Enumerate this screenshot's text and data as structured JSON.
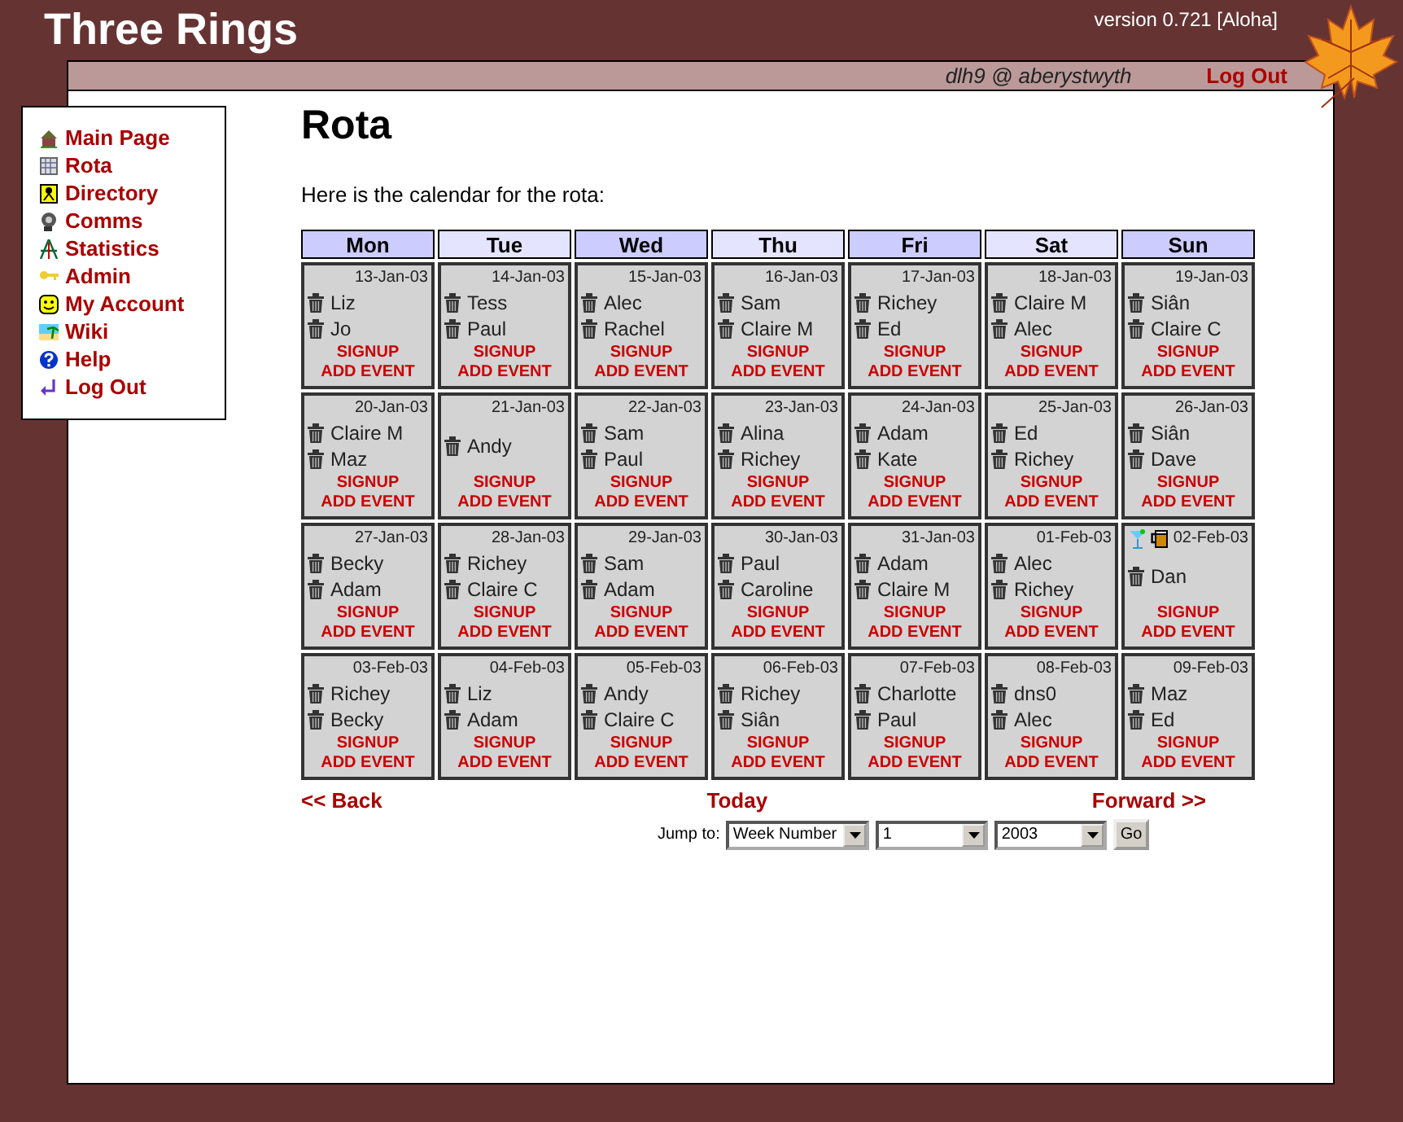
{
  "header": {
    "title": "Three Rings",
    "version": "version 0.721 [Aloha]"
  },
  "topbar": {
    "user": "dlh9 @ aberystwyth",
    "logout": "Log Out"
  },
  "sidebar": {
    "items": [
      {
        "label": "Main Page",
        "kind": "house"
      },
      {
        "label": "Rota",
        "kind": "grid"
      },
      {
        "label": "Directory",
        "kind": "card"
      },
      {
        "label": "Comms",
        "kind": "phone"
      },
      {
        "label": "Statistics",
        "kind": "compass"
      },
      {
        "label": "Admin",
        "kind": "key"
      },
      {
        "label": "My Account",
        "kind": "smiley"
      },
      {
        "label": "Wiki",
        "kind": "beach"
      },
      {
        "label": "Help",
        "kind": "help"
      },
      {
        "label": "Log Out",
        "kind": "return"
      }
    ]
  },
  "page": {
    "title": "Rota",
    "intro": "Here is the calendar for the rota:"
  },
  "calendar": {
    "days": [
      {
        "label": "Mon",
        "color": "#ccccff"
      },
      {
        "label": "Tue",
        "color": "#e4e4ff"
      },
      {
        "label": "Wed",
        "color": "#ccccff"
      },
      {
        "label": "Thu",
        "color": "#e4e4ff"
      },
      {
        "label": "Fri",
        "color": "#ccccff"
      },
      {
        "label": "Sat",
        "color": "#e4e4ff"
      },
      {
        "label": "Sun",
        "color": "#ccccff"
      }
    ],
    "weeks": [
      [
        {
          "date": "13-Jan-03",
          "people": [
            "Liz",
            "Jo"
          ],
          "links": [
            "SIGNUP",
            "ADD EVENT"
          ]
        },
        {
          "date": "14-Jan-03",
          "people": [
            "Tess",
            "Paul"
          ],
          "links": [
            "SIGNUP",
            "ADD EVENT"
          ]
        },
        {
          "date": "15-Jan-03",
          "people": [
            "Alec",
            "Rachel"
          ],
          "links": [
            "SIGNUP",
            "ADD EVENT"
          ]
        },
        {
          "date": "16-Jan-03",
          "people": [
            "Sam",
            "Claire M"
          ],
          "links": [
            "SIGNUP",
            "ADD EVENT"
          ]
        },
        {
          "date": "17-Jan-03",
          "people": [
            "Richey",
            "Ed"
          ],
          "links": [
            "SIGNUP",
            "ADD EVENT"
          ]
        },
        {
          "date": "18-Jan-03",
          "people": [
            "Claire M",
            "Alec"
          ],
          "links": [
            "SIGNUP",
            "ADD EVENT"
          ]
        },
        {
          "date": "19-Jan-03",
          "people": [
            "Siân",
            "Claire C"
          ],
          "links": [
            "SIGNUP",
            "ADD EVENT"
          ]
        }
      ],
      [
        {
          "date": "20-Jan-03",
          "people": [
            "Claire M",
            "Maz"
          ],
          "links": [
            "SIGNUP",
            "ADD EVENT"
          ]
        },
        {
          "date": "21-Jan-03",
          "people": [
            "Andy"
          ],
          "links": [
            "SIGNUP",
            "ADD EVENT"
          ]
        },
        {
          "date": "22-Jan-03",
          "people": [
            "Sam",
            "Paul"
          ],
          "links": [
            "SIGNUP",
            "ADD EVENT"
          ]
        },
        {
          "date": "23-Jan-03",
          "people": [
            "Alina",
            "Richey"
          ],
          "links": [
            "SIGNUP",
            "ADD EVENT"
          ]
        },
        {
          "date": "24-Jan-03",
          "people": [
            "Adam",
            "Kate"
          ],
          "links": [
            "SIGNUP",
            "ADD EVENT"
          ]
        },
        {
          "date": "25-Jan-03",
          "people": [
            "Ed",
            "Richey"
          ],
          "links": [
            "SIGNUP",
            "ADD EVENT"
          ]
        },
        {
          "date": "26-Jan-03",
          "people": [
            "Siân",
            "Dave"
          ],
          "links": [
            "SIGNUP",
            "ADD EVENT"
          ]
        }
      ],
      [
        {
          "date": "27-Jan-03",
          "people": [
            "Becky",
            "Adam"
          ],
          "links": [
            "SIGNUP",
            "ADD EVENT"
          ]
        },
        {
          "date": "28-Jan-03",
          "people": [
            "Richey",
            "Claire C"
          ],
          "links": [
            "SIGNUP",
            "ADD EVENT"
          ]
        },
        {
          "date": "29-Jan-03",
          "people": [
            "Sam",
            "Adam"
          ],
          "links": [
            "SIGNUP",
            "ADD EVENT"
          ]
        },
        {
          "date": "30-Jan-03",
          "people": [
            "Paul",
            "Caroline"
          ],
          "links": [
            "SIGNUP",
            "ADD EVENT"
          ]
        },
        {
          "date": "31-Jan-03",
          "people": [
            "Adam",
            "Claire M"
          ],
          "links": [
            "SIGNUP",
            "ADD EVENT"
          ]
        },
        {
          "date": "01-Feb-03",
          "people": [
            "Alec",
            "Richey"
          ],
          "links": [
            "SIGNUP",
            "ADD EVENT"
          ]
        },
        {
          "date": "02-Feb-03",
          "events": [
            {
              "kind": "cocktail"
            },
            {
              "kind": "beer"
            }
          ],
          "people": [
            "Dan"
          ],
          "links": [
            "SIGNUP",
            "ADD EVENT"
          ]
        }
      ],
      [
        {
          "date": "03-Feb-03",
          "people": [
            "Richey",
            "Becky"
          ],
          "links": [
            "SIGNUP",
            "ADD EVENT"
          ]
        },
        {
          "date": "04-Feb-03",
          "people": [
            "Liz",
            "Adam"
          ],
          "links": [
            "SIGNUP",
            "ADD EVENT"
          ]
        },
        {
          "date": "05-Feb-03",
          "people": [
            "Andy",
            "Claire C"
          ],
          "links": [
            "SIGNUP",
            "ADD EVENT"
          ]
        },
        {
          "date": "06-Feb-03",
          "people": [
            "Richey",
            "Siân"
          ],
          "links": [
            "SIGNUP",
            "ADD EVENT"
          ]
        },
        {
          "date": "07-Feb-03",
          "people": [
            "Charlotte",
            "Paul"
          ],
          "links": [
            "SIGNUP",
            "ADD EVENT"
          ]
        },
        {
          "date": "08-Feb-03",
          "people": [
            "dns0",
            "Alec"
          ],
          "links": [
            "SIGNUP",
            "ADD EVENT"
          ]
        },
        {
          "date": "09-Feb-03",
          "people": [
            "Maz",
            "Ed"
          ],
          "links": [
            "SIGNUP",
            "ADD EVENT"
          ]
        }
      ]
    ]
  },
  "nav": {
    "back": "<< Back",
    "today": "Today",
    "forward": "Forward >>"
  },
  "jump": {
    "label": "Jump to:",
    "mode": "Week Number",
    "week": "1",
    "year": "2003",
    "go": "Go"
  }
}
